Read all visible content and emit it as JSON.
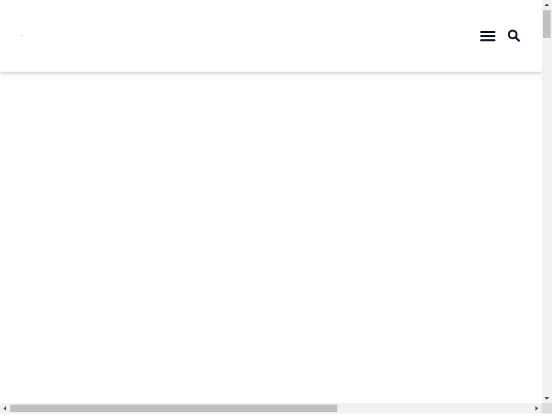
{
  "header": {
    "menu_icon": "hamburger-menu-icon",
    "search_icon": "search-icon",
    "icon_color": "#0e1e2c"
  },
  "scrollbars": {
    "vertical": {
      "position": 0.0
    },
    "horizontal": {
      "position": 0.0
    }
  },
  "colors": {
    "background": "#ffffff",
    "scrollbar_track": "#f1f1f1",
    "scrollbar_thumb": "#c1c1c1"
  }
}
